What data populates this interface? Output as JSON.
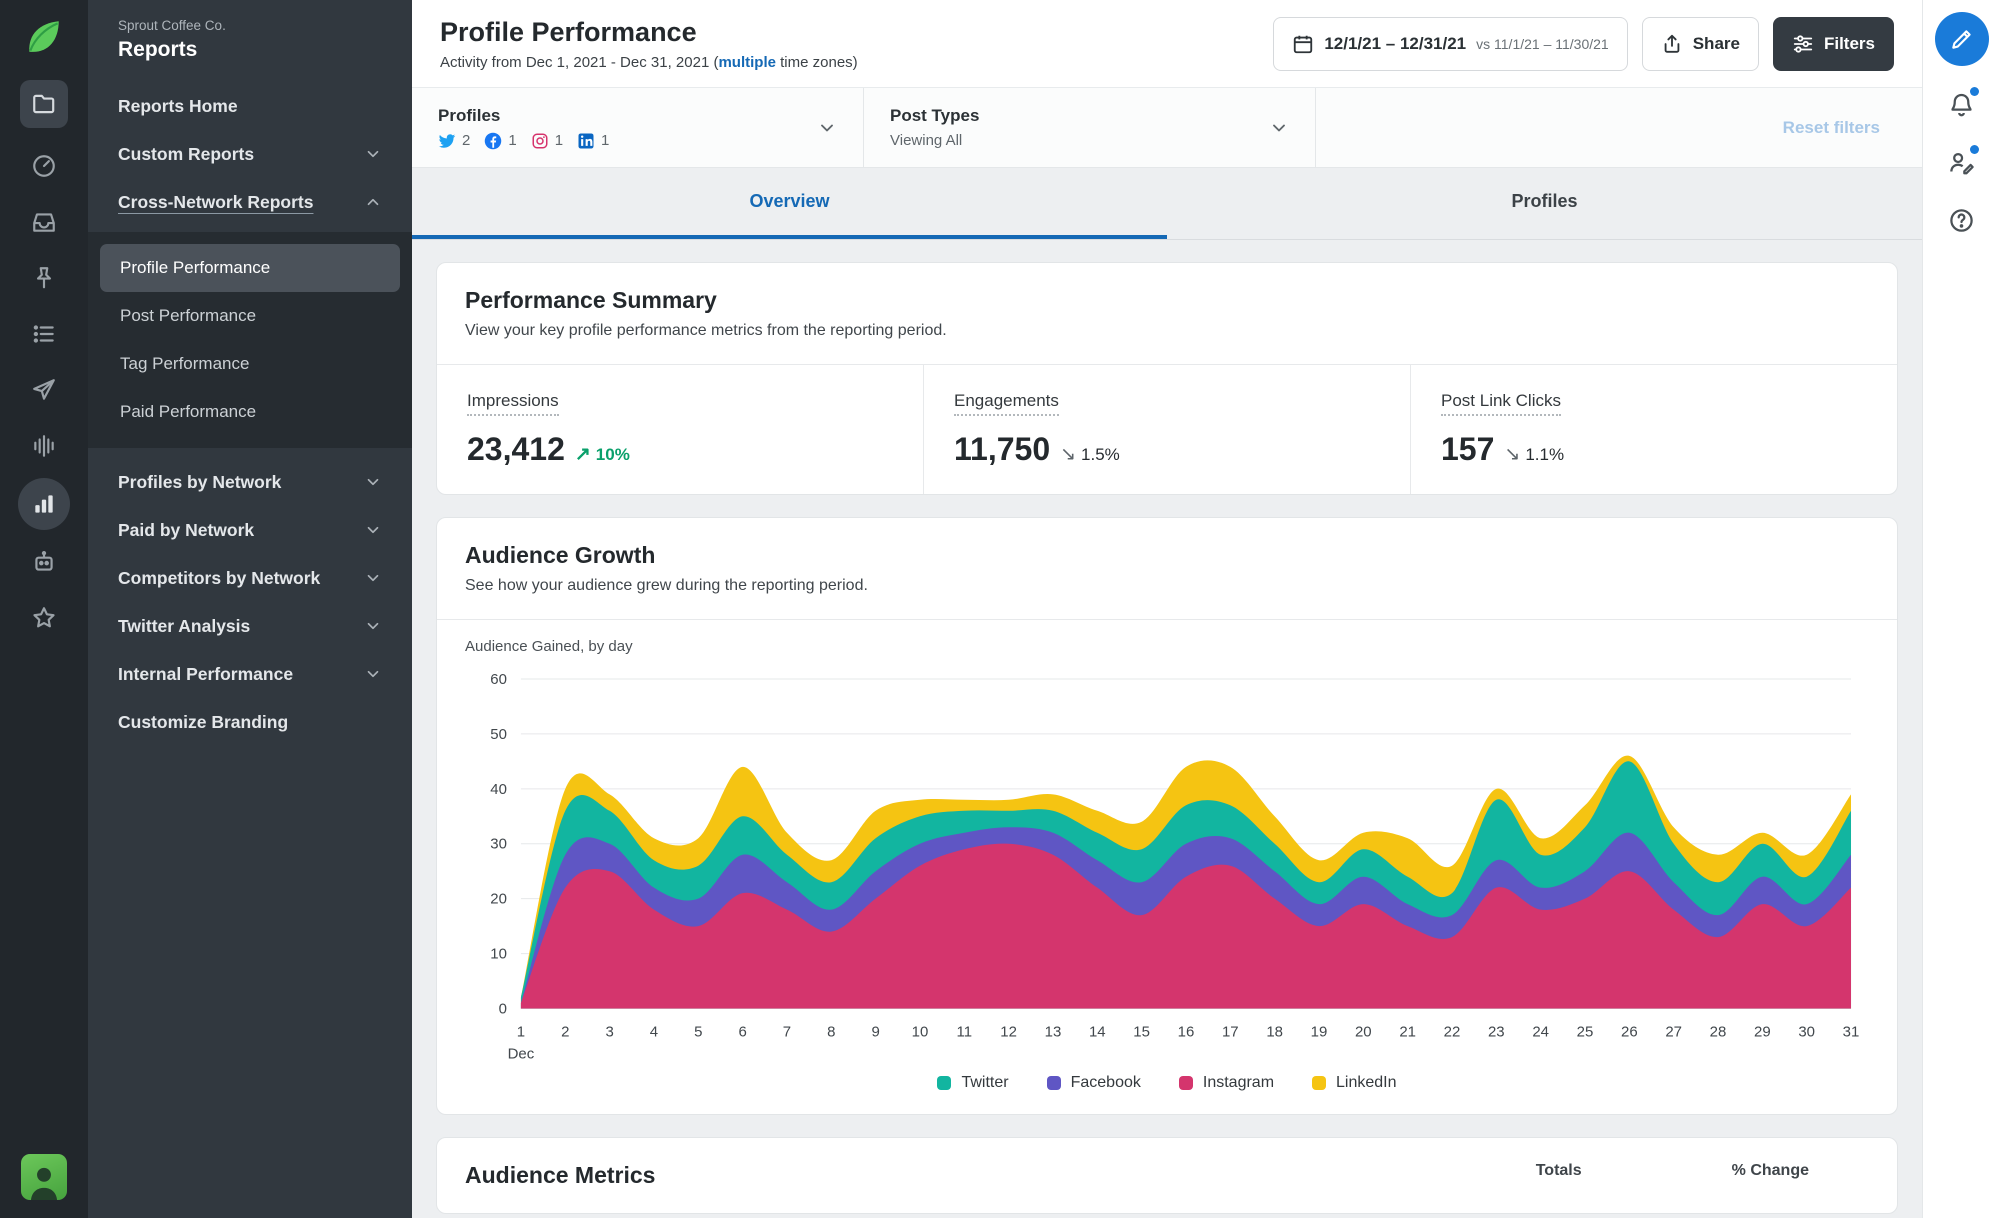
{
  "colors": {
    "accent_blue": "#1569b5",
    "sprout_green": "#5bcb5b",
    "twitter_brand": "#1da1f2",
    "facebook_brand": "#1877f2",
    "instagram_brand": "#d6336c",
    "linkedin_brand": "#0a66c2",
    "trend_up_green": "#0aa06b"
  },
  "icon_rail": {
    "icons": [
      "sprout-logo",
      "reports-app",
      "dashboard",
      "inbox",
      "pin",
      "queue",
      "publish",
      "listening",
      "analytics-active",
      "automation",
      "favorites",
      "user-avatar"
    ]
  },
  "right_rail": {
    "icons": [
      "compose",
      "notifications",
      "feedback",
      "help"
    ]
  },
  "sidebar": {
    "company": "Sprout Coffee Co.",
    "title": "Reports",
    "nav": [
      {
        "label": "Reports Home"
      },
      {
        "label": "Custom Reports",
        "chevron": "down"
      },
      {
        "label": "Cross-Network Reports",
        "chevron": "up"
      }
    ],
    "sub_items": [
      {
        "label": "Profile Performance",
        "selected": true
      },
      {
        "label": "Post Performance"
      },
      {
        "label": "Tag Performance"
      },
      {
        "label": "Paid Performance"
      }
    ],
    "nav2": [
      {
        "label": "Profiles by Network",
        "chevron": "down"
      },
      {
        "label": "Paid by Network",
        "chevron": "down"
      },
      {
        "label": "Competitors by Network",
        "chevron": "down"
      },
      {
        "label": "Twitter Analysis",
        "chevron": "down"
      },
      {
        "label": "Internal Performance",
        "chevron": "down"
      },
      {
        "label": "Customize Branding"
      }
    ]
  },
  "header": {
    "title": "Profile Performance",
    "subtitle_prefix": "Activity from Dec 1, 2021 - Dec 31, 2021 (",
    "subtitle_link": "multiple",
    "subtitle_suffix": " time zones)",
    "date_range": "12/1/21 – 12/31/21",
    "date_compare": "vs 11/1/21 – 11/30/21",
    "share_label": "Share",
    "filters_label": "Filters"
  },
  "filter_bar": {
    "profiles_label": "Profiles",
    "profiles": [
      {
        "network": "Twitter",
        "count": "2"
      },
      {
        "network": "Facebook",
        "count": "1"
      },
      {
        "network": "Instagram",
        "count": "1"
      },
      {
        "network": "LinkedIn",
        "count": "1"
      }
    ],
    "post_types_label": "Post Types",
    "post_types_value": "Viewing All",
    "reset_label": "Reset filters"
  },
  "tabs": [
    {
      "label": "Overview",
      "active": true
    },
    {
      "label": "Profiles",
      "active": false
    }
  ],
  "summary": {
    "title": "Performance Summary",
    "subtitle": "View your key profile performance metrics from the reporting period.",
    "metrics": [
      {
        "label": "Impressions",
        "value": "23,412",
        "delta": "10%",
        "direction": "up"
      },
      {
        "label": "Engagements",
        "value": "11,750",
        "delta": "1.5%",
        "direction": "down"
      },
      {
        "label": "Post Link Clicks",
        "value": "157",
        "delta": "1.1%",
        "direction": "down"
      }
    ]
  },
  "audience": {
    "title": "Audience Growth",
    "subtitle": "See how your audience grew during the reporting period.",
    "chart_label": "Audience Gained, by day"
  },
  "chart_data": {
    "type": "area",
    "stacked": true,
    "title": "Audience Gained, by day",
    "xlabel": "Dec",
    "ylabel": "",
    "month": "Dec",
    "x": [
      1,
      2,
      3,
      4,
      5,
      6,
      7,
      8,
      9,
      10,
      11,
      12,
      13,
      14,
      15,
      16,
      17,
      18,
      19,
      20,
      21,
      22,
      23,
      24,
      25,
      26,
      27,
      28,
      29,
      30,
      31
    ],
    "ylim": [
      0,
      60
    ],
    "yticks": [
      0,
      10,
      20,
      30,
      40,
      50,
      60
    ],
    "grid": true,
    "legend_position": "bottom",
    "stack_order": [
      "Instagram",
      "Facebook",
      "Twitter",
      "LinkedIn"
    ],
    "legend_order": [
      "Twitter",
      "Facebook",
      "Instagram",
      "LinkedIn"
    ],
    "series": [
      {
        "name": "Twitter",
        "color": "#12b5a0",
        "values": [
          1,
          8,
          6,
          5,
          6,
          7,
          5,
          5,
          6,
          5,
          4,
          3,
          4,
          5,
          6,
          7,
          6,
          5,
          4,
          5,
          5,
          4,
          11,
          6,
          8,
          13,
          7,
          6,
          6,
          5,
          8
        ]
      },
      {
        "name": "Facebook",
        "color": "#5f56c4",
        "values": [
          0,
          6,
          5,
          4,
          5,
          7,
          5,
          4,
          5,
          4,
          3,
          3,
          4,
          5,
          6,
          6,
          5,
          5,
          4,
          5,
          4,
          4,
          5,
          4,
          5,
          7,
          5,
          4,
          5,
          4,
          6
        ]
      },
      {
        "name": "Instagram",
        "color": "#d4356d",
        "values": [
          1,
          22,
          25,
          18,
          15,
          21,
          18,
          14,
          20,
          26,
          29,
          30,
          28,
          22,
          17,
          24,
          26,
          20,
          15,
          19,
          15,
          13,
          22,
          18,
          20,
          25,
          18,
          13,
          19,
          15,
          22
        ]
      },
      {
        "name": "LinkedIn",
        "color": "#f5c412",
        "values": [
          0,
          4,
          3,
          4,
          5,
          9,
          4,
          4,
          5,
          3,
          2,
          2,
          3,
          4,
          5,
          7,
          7,
          5,
          4,
          3,
          7,
          5,
          2,
          3,
          4,
          1,
          3,
          5,
          2,
          4,
          3
        ]
      }
    ]
  },
  "metrics_table": {
    "title": "Audience Metrics",
    "columns": [
      "Totals",
      "% Change"
    ]
  }
}
